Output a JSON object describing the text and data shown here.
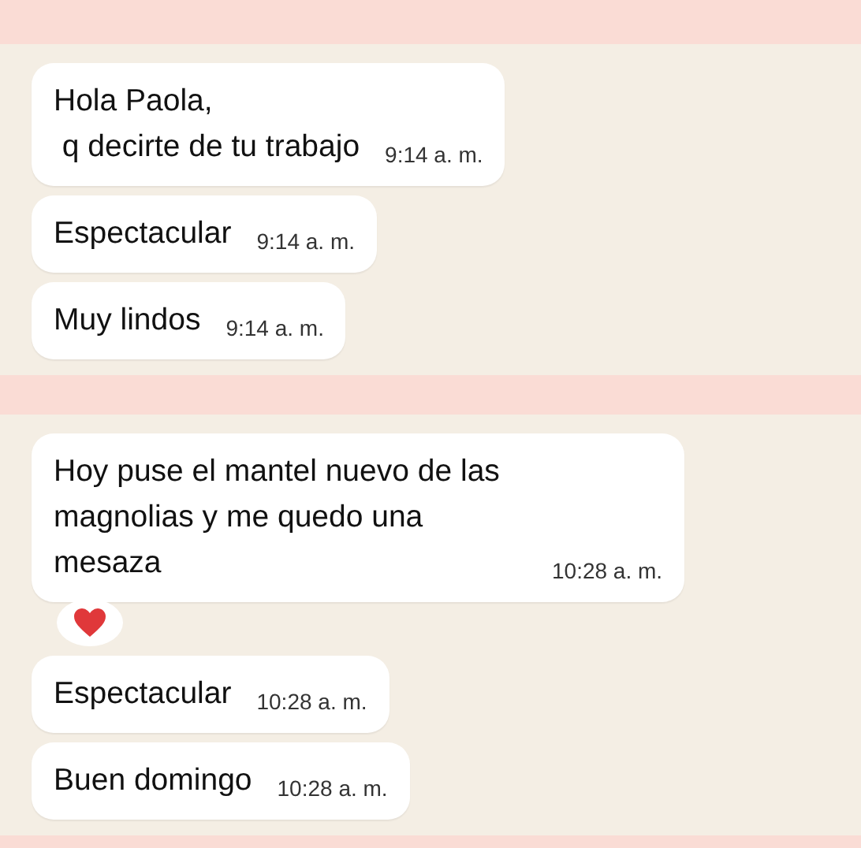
{
  "panels": [
    {
      "messages": [
        {
          "text": "Hola Paola,\n q decirte de tu trabajo",
          "time": "9:14 a. m."
        },
        {
          "text": "Espectacular",
          "time": "9:14 a. m."
        },
        {
          "text": "Muy lindos",
          "time": "9:14 a. m."
        }
      ]
    },
    {
      "messages": [
        {
          "text": "Hoy puse el mantel nuevo de las magnolias y me quedo una mesaza",
          "time": "10:28 a. m.",
          "heart_reaction": true
        },
        {
          "text": "Espectacular",
          "time": "10:28 a. m."
        },
        {
          "text": "Buen domingo",
          "time": "10:28 a. m."
        }
      ]
    }
  ]
}
